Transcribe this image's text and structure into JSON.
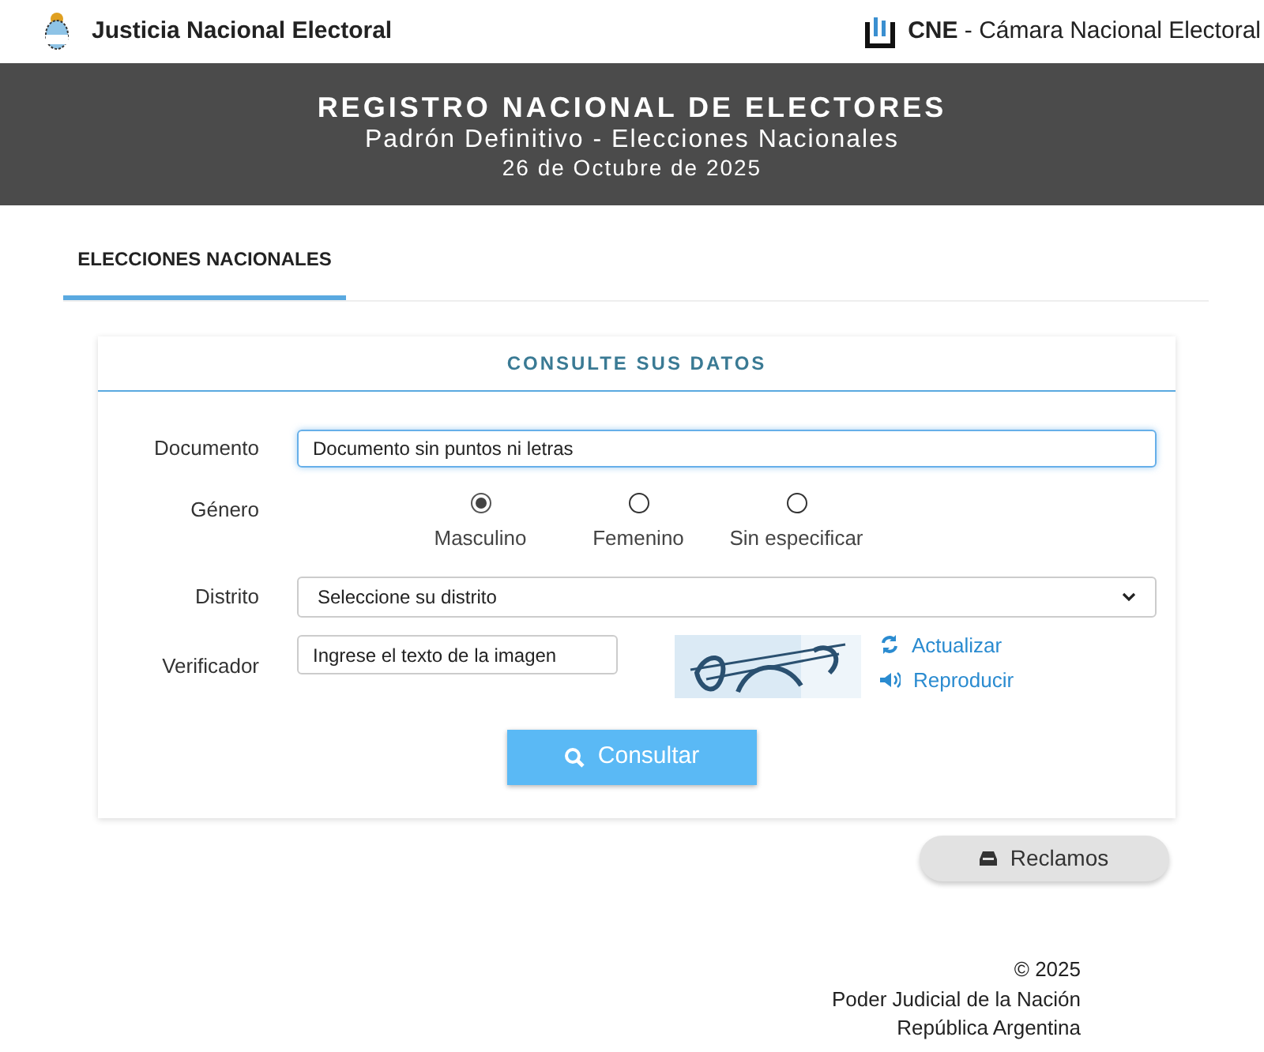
{
  "header": {
    "left_title": "Justicia Nacional Electoral",
    "right_title": "**CNE** - Cámara Nacional Electoral"
  },
  "banner": {
    "title": "REGISTRO NACIONAL DE ELECTORES",
    "subtitle": "Padrón Definitivo - Elecciones Nacionales",
    "date": "26 de Octubre de 2025"
  },
  "tabs": [
    {
      "label": "ELECCIONES NACIONALES",
      "selected": true
    }
  ],
  "form": {
    "title": "CONSULTE SUS DATOS",
    "document": {
      "label": "Documento",
      "placeholder": "Documento sin puntos ni letras"
    },
    "gender": {
      "label": "Género",
      "options": [
        {
          "label": "Masculino",
          "selected": true
        },
        {
          "label": "Femenino",
          "selected": false
        },
        {
          "label": "Sin especificar",
          "selected": false
        }
      ]
    },
    "district": {
      "label": "Distrito",
      "value": "Seleccione su distrito"
    },
    "verifier": {
      "label": "Verificador",
      "placeholder": "Ingrese el texto de la imagen",
      "refresh": "Actualizar",
      "play": "Reproducir"
    },
    "submit": "Consultar"
  },
  "claims_button": "Reclamos",
  "footer": [
    "© 2025",
    "Poder Judicial de la Nación",
    "República Argentina"
  ]
}
